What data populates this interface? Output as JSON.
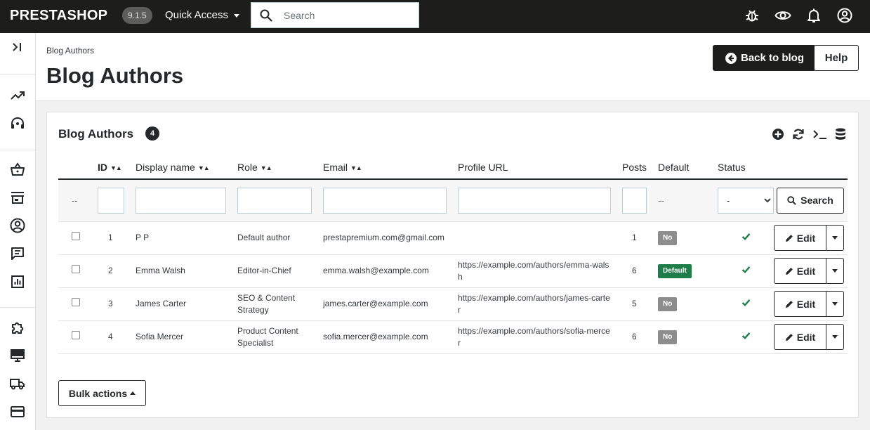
{
  "topbar": {
    "logo": "PRESTASHOP",
    "version": "9.1.5",
    "quick_access": "Quick Access",
    "search_placeholder": "Search",
    "icons": [
      "bug-icon",
      "eye-icon",
      "bell-icon",
      "user-circle-icon"
    ]
  },
  "sidebar": {
    "icons": [
      "collapse-icon",
      "trending-icon",
      "headset-icon",
      "basket-icon",
      "store-icon",
      "customer-icon",
      "message-icon",
      "stats-icon",
      "puzzle-icon",
      "monitor-icon",
      "truck-icon",
      "credit-card-icon"
    ]
  },
  "header": {
    "breadcrumb": "Blog Authors",
    "title": "Blog Authors",
    "back_label": "Back to blog",
    "help_label": "Help"
  },
  "card": {
    "title": "Blog Authors",
    "count": "4",
    "tools": [
      "add-icon",
      "refresh-icon",
      "terminal-icon",
      "database-icon"
    ]
  },
  "table": {
    "columns": {
      "id": "ID",
      "display_name": "Display name",
      "role": "Role",
      "email": "Email",
      "profile_url": "Profile URL",
      "posts": "Posts",
      "default": "Default",
      "status": "Status"
    },
    "filters": {
      "bulk_placeholder": "--",
      "default_placeholder": "--",
      "status_selected": "-",
      "search_label": "Search"
    },
    "rows": [
      {
        "id": "1",
        "name": "P P",
        "role": "Default author",
        "email": "prestapremium.com@gmail.com",
        "url": "",
        "posts": "1",
        "default": "No",
        "status": "active"
      },
      {
        "id": "2",
        "name": "Emma Walsh",
        "role": "Editor-in-Chief",
        "email": "emma.walsh@example.com",
        "url": "https://example.com/authors/emma-walsh",
        "posts": "6",
        "default": "Default",
        "status": "active"
      },
      {
        "id": "3",
        "name": "James Carter",
        "role": "SEO & Content Strategy",
        "email": "james.carter@example.com",
        "url": "https://example.com/authors/james-carter",
        "posts": "5",
        "default": "No",
        "status": "active"
      },
      {
        "id": "4",
        "name": "Sofia Mercer",
        "role": "Product Content Specialist",
        "email": "sofia.mercer@example.com",
        "url": "https://example.com/authors/sofia-mercer",
        "posts": "6",
        "default": "No",
        "status": "active"
      }
    ],
    "edit_label": "Edit"
  },
  "bulk_actions_label": "Bulk actions",
  "colors": {
    "dark": "#1d1d1b",
    "success": "#1f7d4a",
    "muted_badge": "#8d8d8d"
  }
}
